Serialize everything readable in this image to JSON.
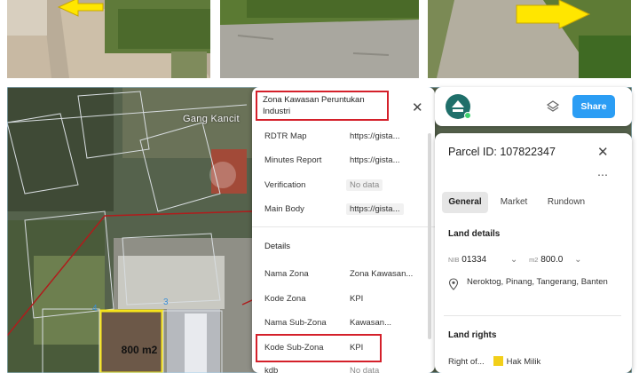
{
  "map": {
    "street_label": "Gang Kancit",
    "parcel_area_label": "800 m2",
    "parcel_numbers": [
      "4",
      "3"
    ]
  },
  "rdtr_popup": {
    "header": "Zona Kawasan Peruntukan Industri",
    "rows": [
      {
        "label": "RDTR Map",
        "value": "https://gista..."
      },
      {
        "label": "Minutes Report",
        "value": "https://gista..."
      },
      {
        "label": "Verification",
        "value": "No data"
      },
      {
        "label": "Main Body",
        "value": "https://gista..."
      }
    ],
    "details_heading": "Details",
    "details": [
      {
        "label": "Nama Zona",
        "value": "Zona Kawasan..."
      },
      {
        "label": "Kode Zona",
        "value": "KPI"
      },
      {
        "label": "Nama Sub-Zona",
        "value": "Kawasan..."
      },
      {
        "label": "Kode Sub-Zona",
        "value": "KPI"
      },
      {
        "label": "kdb",
        "value": "No data"
      }
    ]
  },
  "topbar": {
    "share_label": "Share",
    "behind_text": "Gang Kancit"
  },
  "parcel": {
    "title": "Parcel ID: 107822347",
    "tabs": [
      "General",
      "Market",
      "Rundown"
    ],
    "active_tab": "General",
    "land_details_title": "Land details",
    "nib_label": "NIB",
    "nib_value": "01334",
    "area_unit": "m2",
    "area_value": "800.0",
    "address": "Neroktog, Pinang, Tangerang, Banten",
    "land_rights_title": "Land rights",
    "right_of_label": "Right of...",
    "right_value": "Hak Milik",
    "right_color": "#f2cf1a"
  },
  "colors": {
    "highlight": "#d4202a",
    "share": "#2b9df4",
    "brand": "#1f6f6a"
  }
}
